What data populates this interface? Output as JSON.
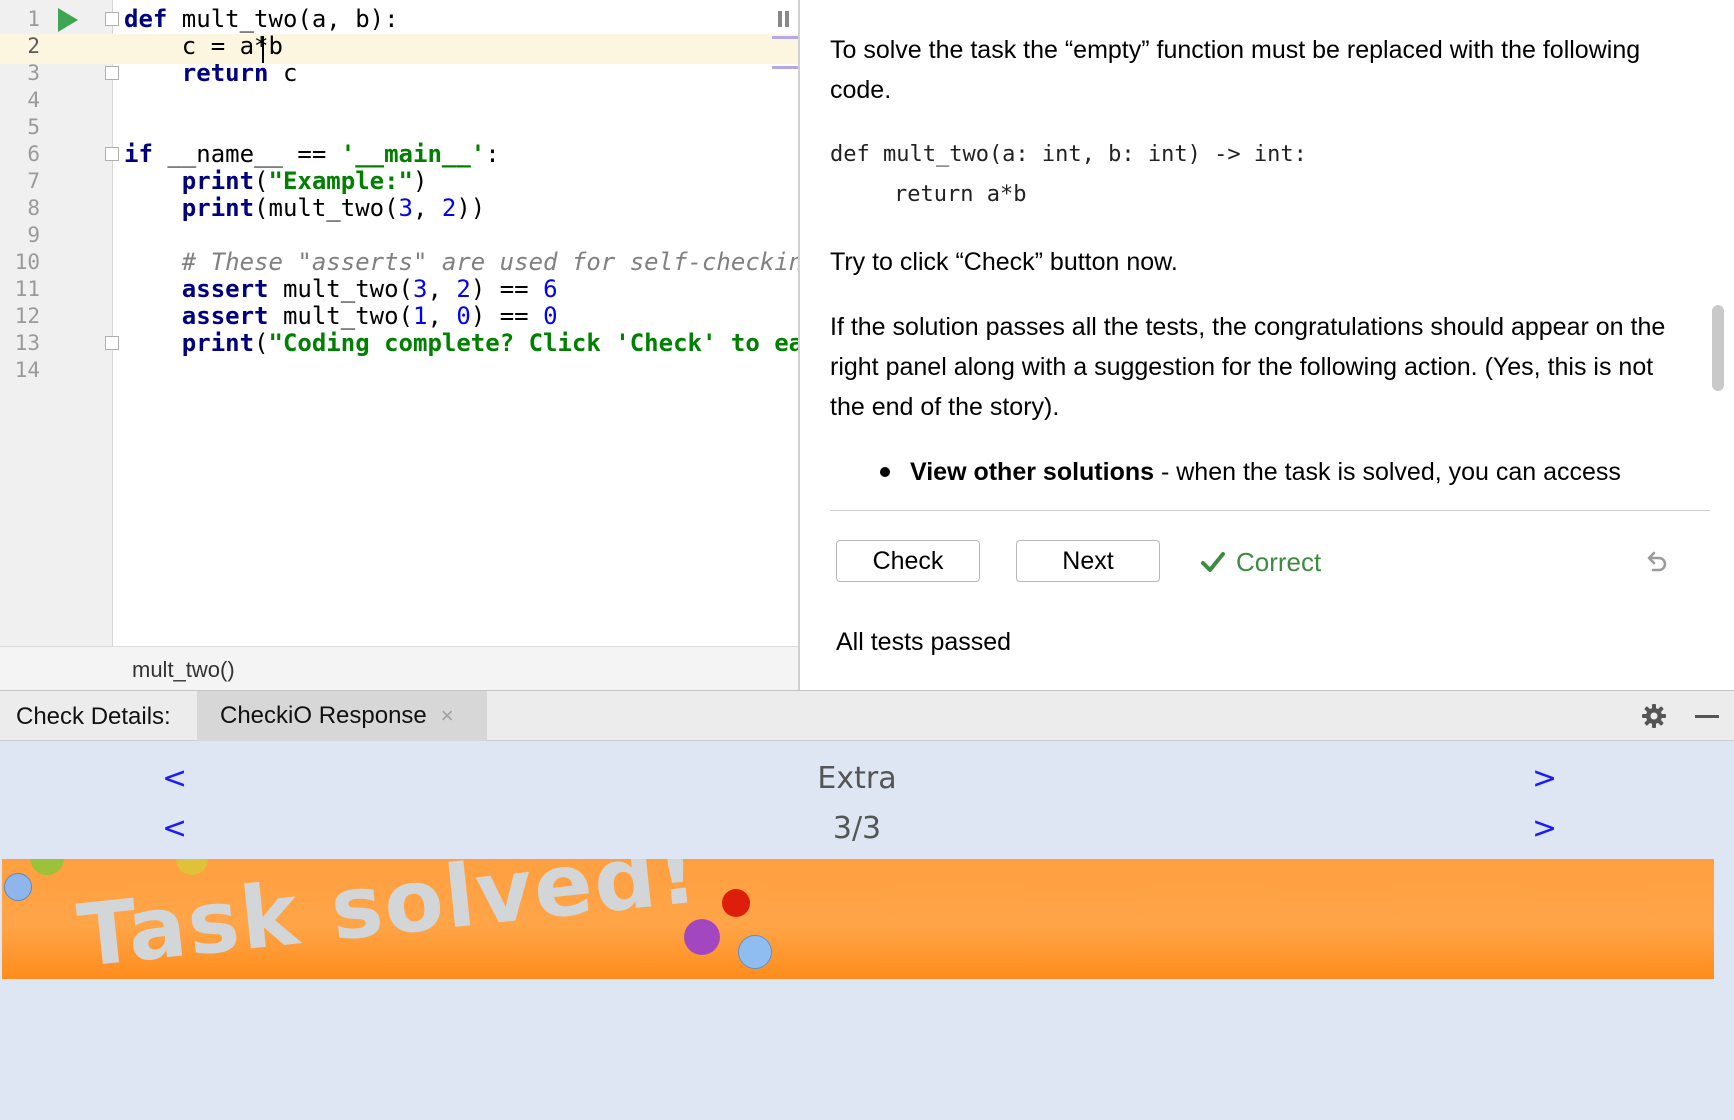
{
  "editor": {
    "line_numbers": [
      "1",
      "2",
      "3",
      "4",
      "5",
      "6",
      "7",
      "8",
      "9",
      "10",
      "11",
      "12",
      "13",
      "14"
    ],
    "breadcrumb": "mult_two()"
  },
  "task": {
    "paragraph1": "To solve the task the “empty” function must be replaced with the following code.",
    "code_line1": "def mult_two(a: int, b: int) -> int:",
    "code_line2": "return a*b",
    "paragraph2": "Try to click “Check” button now.",
    "paragraph3": "If the solution passes all the tests, the congratulations should appear on the right panel along with a suggestion for the following action. (Yes, this is not the end of the story).",
    "bullet_bold": "View other solutions",
    "bullet_text": " - when the task is solved, you can access",
    "check_label": "Check",
    "next_label": "Next",
    "status_label": "Correct",
    "tests_status": "All tests passed"
  },
  "tool_window": {
    "title": "Check Details:",
    "tab_label": "CheckiO Response",
    "tab_close": "×",
    "nav_rows": [
      {
        "prev": "<",
        "label": "Extra",
        "next": ">"
      },
      {
        "prev": "<",
        "label": "3/3",
        "next": ">"
      }
    ],
    "banner_text": "Task solved!"
  },
  "colors": {
    "run_green": "#3fa553",
    "correct_green": "#3d8b40",
    "banner_orange": "#ff9f40",
    "nav_blue": "#1b1bff",
    "panel_blue": "#dde6f2"
  }
}
